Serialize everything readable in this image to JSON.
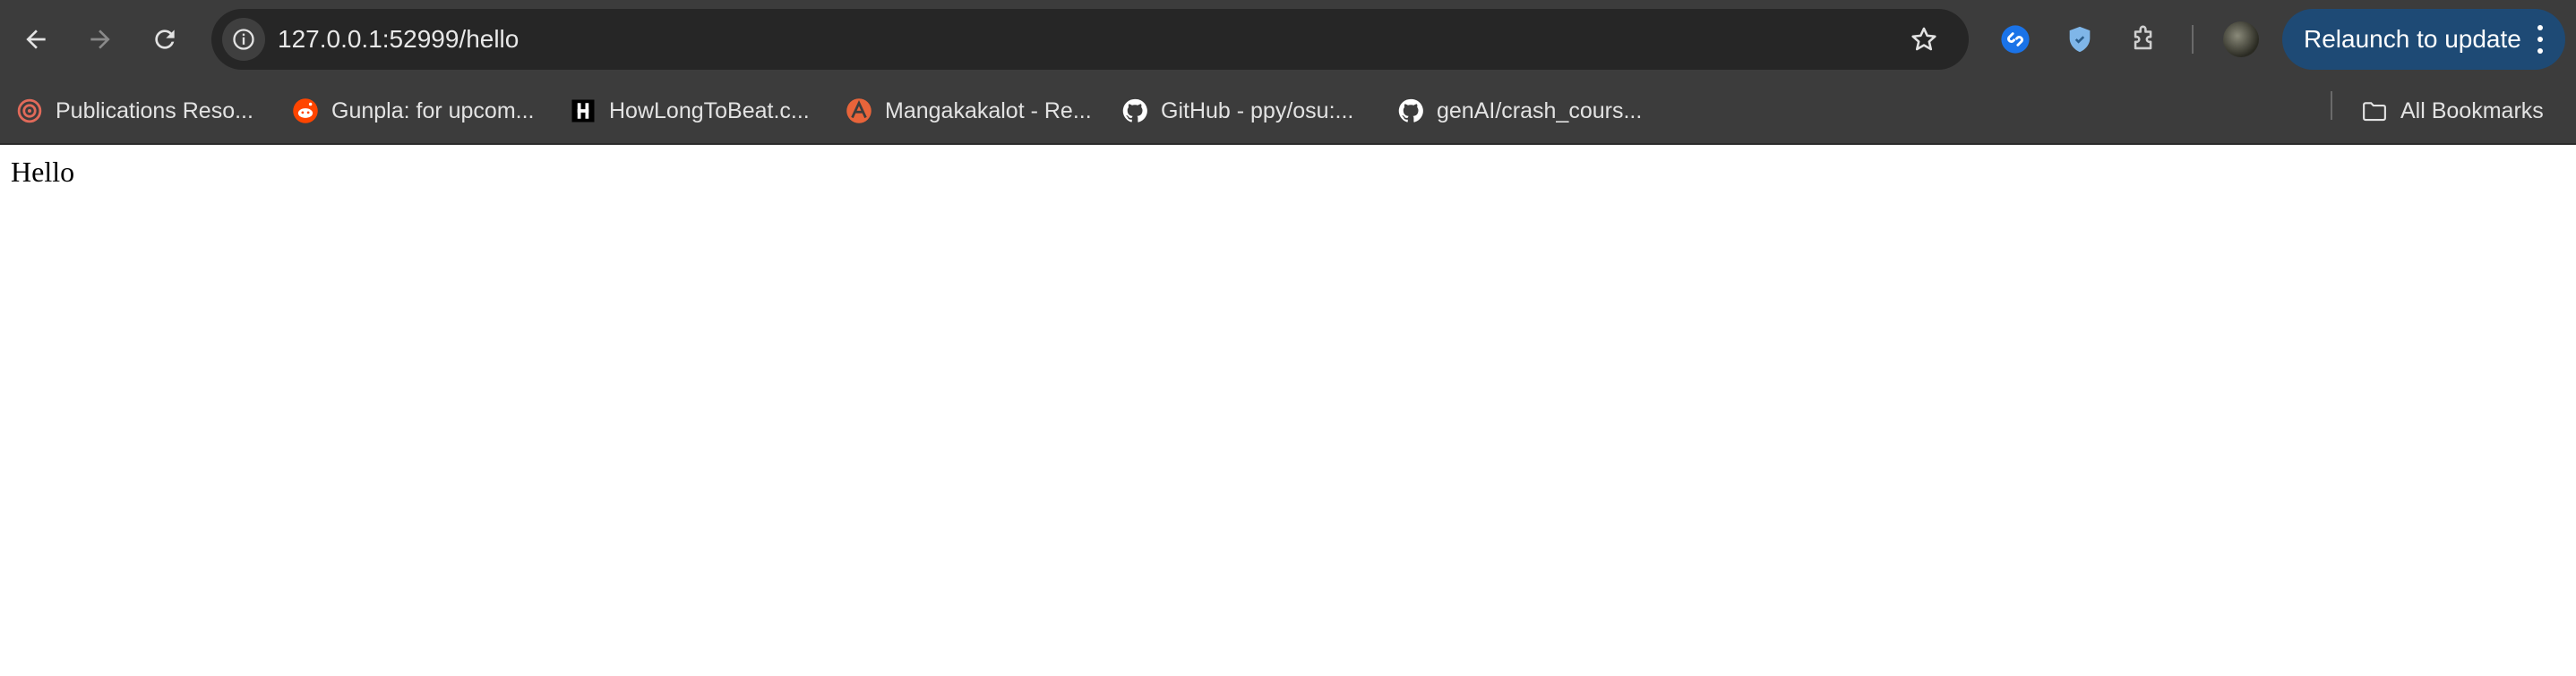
{
  "toolbar": {
    "url": "127.0.0.1:52999/hello",
    "back_icon": "back-arrow-icon",
    "forward_icon": "forward-arrow-icon",
    "reload_icon": "reload-icon",
    "site_info_icon": "info-icon",
    "bookmark_star_icon": "star-icon",
    "relaunch_label": "Relaunch to update",
    "menu_icon": "kebab-menu-icon",
    "relaunch_color": "#1e4a75"
  },
  "extensions": [
    {
      "name": "shazam",
      "icon": "shazam-icon",
      "color": "#1a73e8"
    },
    {
      "name": "shield-extension",
      "icon": "shield-icon",
      "color": "#7fb6e8"
    },
    {
      "name": "extensions",
      "icon": "puzzle-icon",
      "color": "#cfcfcf"
    }
  ],
  "bookmarks": {
    "items": [
      {
        "label": "Publications Reso...",
        "icon": "target-icon",
        "color": "#e26a5a"
      },
      {
        "label": "Gunpla: for upcom...",
        "icon": "reddit-icon",
        "color": "#ff4500"
      },
      {
        "label": "HowLongToBeat.c...",
        "icon": "hltb-icon",
        "color": "#000000"
      },
      {
        "label": "Mangakakalot - Re...",
        "icon": "mangakakalot-icon",
        "color": "#e8643a"
      },
      {
        "label": "GitHub - ppy/osu:...",
        "icon": "github-icon",
        "color": "#ffffff"
      },
      {
        "label": "genAI/crash_cours...",
        "icon": "github-icon",
        "color": "#ffffff"
      }
    ],
    "all_bookmarks_label": "All Bookmarks",
    "all_bookmarks_icon": "folder-icon"
  },
  "page": {
    "body_text": "Hello"
  }
}
